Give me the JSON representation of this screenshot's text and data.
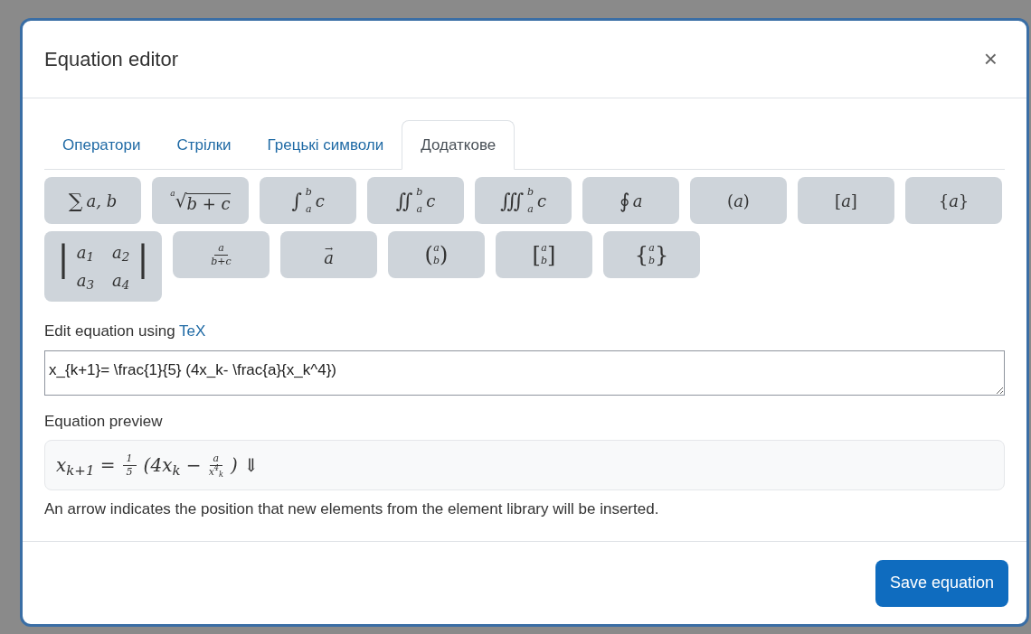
{
  "dialog": {
    "title": "Equation editor",
    "close": "×"
  },
  "tabs": [
    {
      "label": "Оператори",
      "selected": false
    },
    {
      "label": "Стрілки",
      "selected": false
    },
    {
      "label": "Грецькі символи",
      "selected": false
    },
    {
      "label": "Додаткове",
      "selected": true
    }
  ],
  "elements": [
    {
      "kind": "symbol",
      "symbol": "∑",
      "body": "a, b"
    },
    {
      "kind": "root",
      "symbol": "√",
      "index": "a",
      "radicand": "b + c"
    },
    {
      "kind": "integral",
      "symbol": "∫",
      "lower": "a",
      "upper": "b",
      "body": "c"
    },
    {
      "kind": "integral",
      "symbol": "∬",
      "lower": "a",
      "upper": "b",
      "body": "c"
    },
    {
      "kind": "integral",
      "symbol": "∭",
      "lower": "a",
      "upper": "b",
      "body": "c"
    },
    {
      "kind": "symbol",
      "symbol": "∮",
      "body": "a"
    },
    {
      "kind": "delim",
      "open": "(",
      "close": ")",
      "body": "a"
    },
    {
      "kind": "delim",
      "open": "[",
      "close": "]",
      "body": "a"
    },
    {
      "kind": "delim",
      "open": "{",
      "close": "}",
      "body": "a"
    },
    {
      "kind": "matrix",
      "open": "|",
      "close": "|",
      "rows": [
        [
          "a$_{1}$",
          "a$_{2}$"
        ],
        [
          "a$_{3}$",
          "a$_{4}$"
        ]
      ]
    },
    {
      "kind": "frac",
      "numerator": "a",
      "denominator": "b+c"
    },
    {
      "kind": "vector",
      "accent": "→",
      "body": "a"
    },
    {
      "kind": "stack",
      "open": "(",
      "close": ")",
      "top": "a",
      "bottom": "b"
    },
    {
      "kind": "stack",
      "open": "[",
      "close": "]",
      "top": "a",
      "bottom": "b"
    },
    {
      "kind": "stack",
      "open": "{",
      "close": "}",
      "top": "a",
      "bottom": "b"
    }
  ],
  "tex_label": {
    "text": "Edit equation using",
    "link": "TeX"
  },
  "tex_value": "x_{k+1}= \\frac{1}{5} (4x_k- \\frac{a}{x_k^4})",
  "preview_label": "Equation preview",
  "preview": [
    {
      "kind": "text",
      "text": "x$_{k+1}$ ="
    },
    {
      "kind": "frac",
      "numerator": "1",
      "denominator": "5"
    },
    {
      "kind": "text",
      "text": "(4x$_{k}$ −"
    },
    {
      "kind": "frac",
      "numerator": "a",
      "denominator": "x$^{4}$$_{k}$"
    },
    {
      "kind": "text",
      "text": ") ⇓"
    }
  ],
  "note": "An arrow indicates the position that new elements from the element library will be inserted.",
  "save_button": "Save equation"
}
